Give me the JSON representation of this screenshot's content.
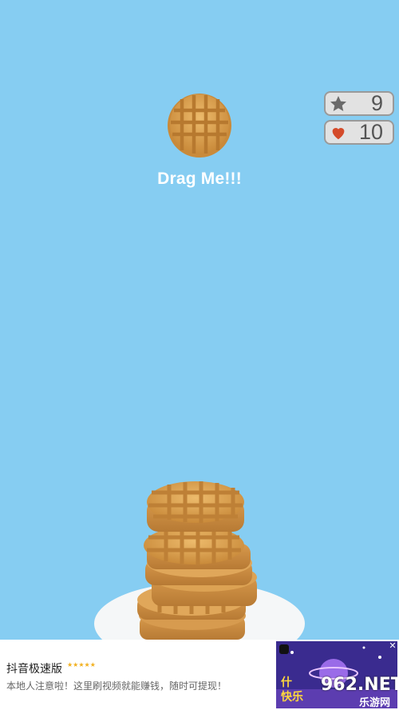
{
  "hud": {
    "stars": "9",
    "lives": "10"
  },
  "prompt": {
    "drag_text": "Drag Me!!!"
  },
  "ad": {
    "title": "抖音极速版",
    "rating": "★★★★★",
    "description": "本地人注意啦！这里刷视频就能赚钱，随时可提现！",
    "badge_text": "962.NET",
    "badge_sub": "乐游网",
    "close_label": "✕"
  },
  "colors": {
    "sky": "#86cdf2",
    "waffle": "#dca253",
    "plate": "#f5f7f8"
  }
}
